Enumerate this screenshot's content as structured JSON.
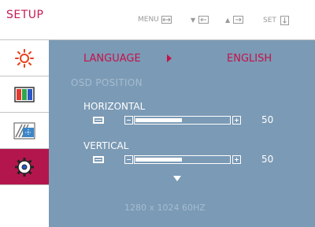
{
  "header": {
    "title": "SETUP",
    "hints": {
      "menu": "MENU",
      "set": "SET"
    }
  },
  "sidebar": {
    "items": [
      {
        "icon": "brightness-icon"
      },
      {
        "icon": "color-bars-icon"
      },
      {
        "icon": "tracking-icon"
      },
      {
        "icon": "setup-gear-icon",
        "active": true
      }
    ]
  },
  "menu": {
    "language": {
      "label": "LANGUAGE",
      "value": "ENGLISH"
    },
    "osd_position": {
      "label": "OSD POSITION",
      "horizontal": {
        "label": "HORIZONTAL",
        "value": "50",
        "level": 50
      },
      "vertical": {
        "label": "VERTICAL",
        "value": "50",
        "level": 50
      }
    }
  },
  "status": {
    "resolution": "1280 x 1024  60HZ"
  },
  "colors": {
    "accent": "#c4124a",
    "panel": "#7b9ab5",
    "active_tab": "#b3164d"
  }
}
